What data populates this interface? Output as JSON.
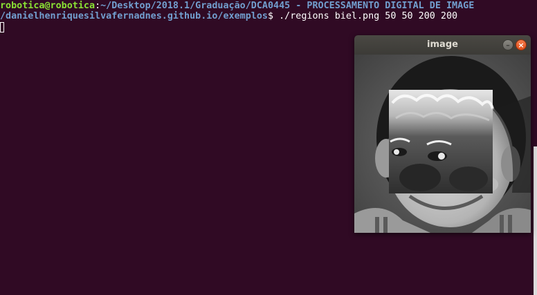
{
  "terminal": {
    "prompt_user": "robotica@robotica",
    "prompt_sep": ":",
    "prompt_path_line1": "~/Desktop/2018.1/Graduação/DCA0445 - PROCESSAMENTO DIGITAL DE IMAGE",
    "prompt_path_line2": "/danielhenriquesilvafernadnes.github.io/exemplos",
    "prompt_symbol": "$",
    "command": " ./regions biel.png 50 50 200 200"
  },
  "image_window": {
    "title": "image",
    "minimize_glyph": "–",
    "close_glyph": "×"
  },
  "colors": {
    "terminal_bg": "#300a24",
    "prompt_user": "#8ae234",
    "prompt_path": "#729fcf",
    "close_button": "#e95420"
  }
}
